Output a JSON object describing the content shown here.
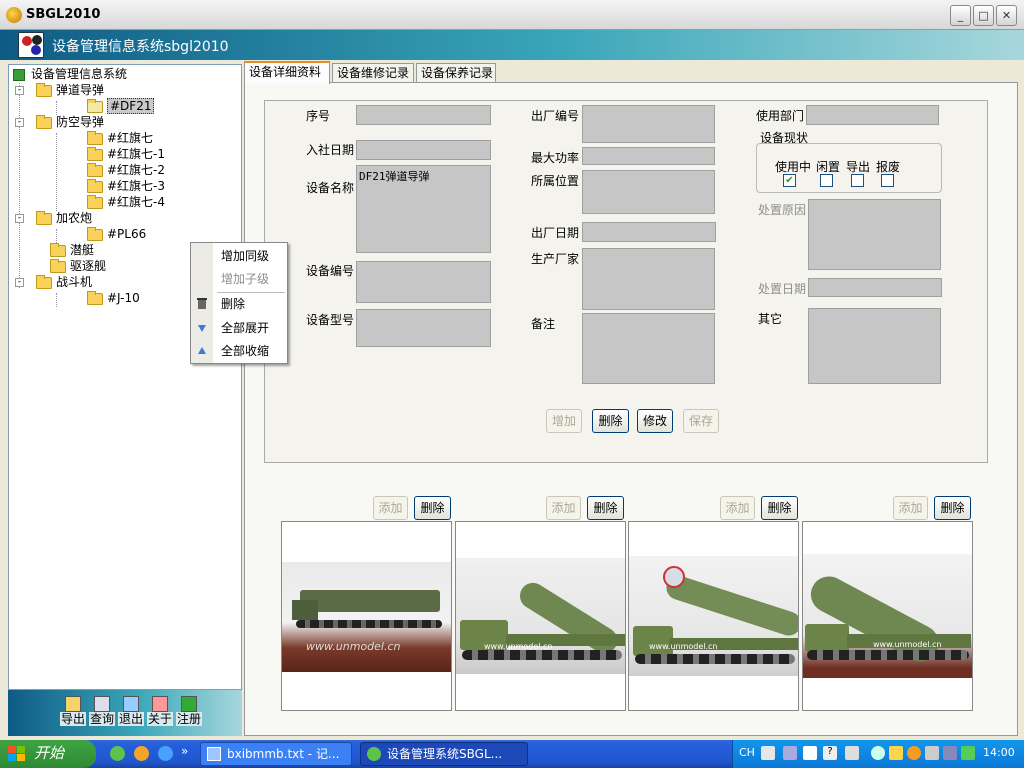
{
  "window": {
    "title": "SBGL2010"
  },
  "banner": {
    "title": "设备管理信息系统sbgl2010"
  },
  "tree": {
    "root": "设备管理信息系统",
    "groups": [
      {
        "label": "弹道导弹",
        "children": [
          "#DF21"
        ]
      },
      {
        "label": "防空导弹",
        "children": [
          "#红旗七",
          "#红旗七-1",
          "#红旗七-2",
          "#红旗七-3",
          "#红旗七-4"
        ]
      },
      {
        "label": "加农炮",
        "children": [
          "#PL66"
        ]
      },
      {
        "label": "潜艇",
        "children": []
      },
      {
        "label": "驱逐舰",
        "children": []
      },
      {
        "label": "战斗机",
        "children": [
          "#J-10"
        ]
      }
    ]
  },
  "context_menu": {
    "items": [
      {
        "label": "增加同级",
        "enabled": true
      },
      {
        "label": "增加子级",
        "enabled": false
      },
      {
        "label": "删除",
        "enabled": true,
        "icon": "trash-icon"
      },
      {
        "label": "全部展开",
        "enabled": true,
        "icon": "arrow-down-icon"
      },
      {
        "label": "全部收缩",
        "enabled": true,
        "icon": "arrow-up-icon"
      }
    ]
  },
  "left_toolbar": {
    "export": "导出",
    "query": "查询",
    "exit": "退出",
    "about": "关于",
    "register": "注册"
  },
  "tabs": [
    "设备详细资料",
    "设备维修记录",
    "设备保养记录"
  ],
  "form": {
    "serial_label": "序号",
    "join_date_label": "入社日期",
    "device_name_label": "设备名称",
    "device_name_value": "DF21弹道导弹",
    "device_no_label": "设备编号",
    "device_model_label": "设备型号",
    "factory_no_label": "出厂编号",
    "max_power_label": "最大功率",
    "location_label": "所属位置",
    "factory_date_label": "出厂日期",
    "manufacturer_label": "生产厂家",
    "remark_label": "备注",
    "department_label": "使用部门",
    "status_label": "设备现状",
    "status_options": [
      {
        "label": "使用中",
        "checked": true
      },
      {
        "label": "闲置",
        "checked": false
      },
      {
        "label": "导出",
        "checked": false
      },
      {
        "label": "报废",
        "checked": false
      }
    ],
    "disposal_reason_label": "处置原因",
    "disposal_date_label": "处置日期",
    "other_label": "其它"
  },
  "form_buttons": {
    "add": "增加",
    "delete": "删除",
    "edit": "修改",
    "save": "保存"
  },
  "image_buttons": {
    "add": "添加",
    "delete": "删除"
  },
  "images": [
    {
      "watermark": "www.unmodel.cn"
    },
    {
      "watermark": "www.unmodel.cn"
    },
    {
      "watermark": "www.unmodel.cn"
    },
    {
      "watermark": "www.unmodel.cn"
    }
  ],
  "taskbar": {
    "start": "开始",
    "tasks": [
      "bxibmmb.txt - 记...",
      "设备管理系统SBGL..."
    ],
    "ime": "CH",
    "clock": "14:00"
  },
  "colors": {
    "banner": "#3aa6b9",
    "taskbar": "#245edb",
    "start": "#3fa443",
    "tab_accent": "#e68b2c"
  }
}
